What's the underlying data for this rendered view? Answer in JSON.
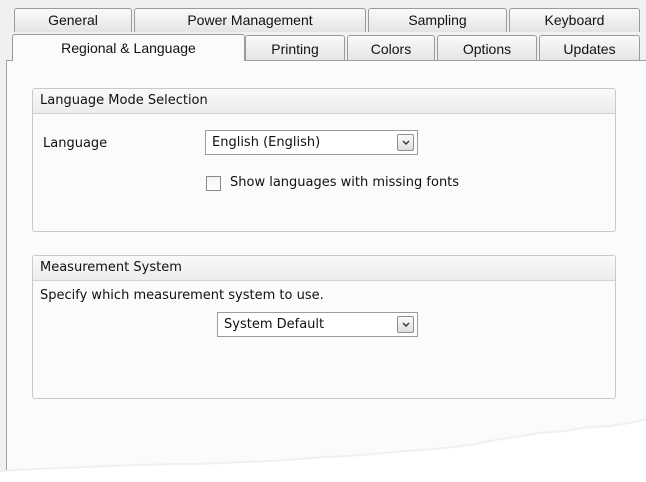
{
  "tabs": {
    "row1": [
      "General",
      "Power Management",
      "Sampling",
      "Keyboard"
    ],
    "row2": [
      "Regional & Language",
      "Printing",
      "Colors",
      "Options",
      "Updates"
    ],
    "active": "Regional & Language"
  },
  "language_group": {
    "title": "Language Mode Selection",
    "language_label": "Language",
    "language_value": "English (English)",
    "missing_fonts_label": "Show languages with missing fonts",
    "missing_fonts_checked": false
  },
  "measurement_group": {
    "title": "Measurement System",
    "description": "Specify which measurement system to use.",
    "value": "System Default"
  },
  "colors": {
    "panel": "#fbfbfb",
    "tab_border": "#9a9a9a",
    "group_border": "#c9c9c9"
  }
}
